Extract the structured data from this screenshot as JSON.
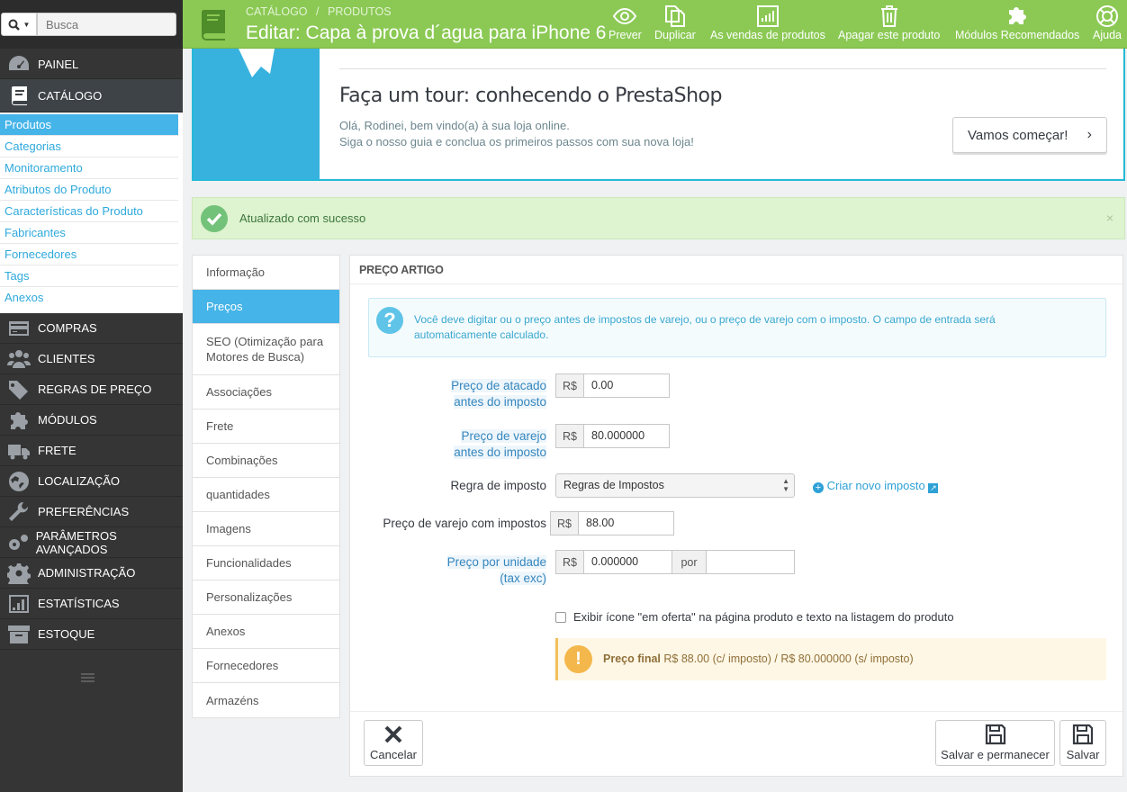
{
  "sidebar": {
    "search_placeholder": "Busca",
    "nav": [
      {
        "label": "PAINEL",
        "icon": "dashboard-icon"
      },
      {
        "label": "CATÁLOGO",
        "icon": "book-icon"
      },
      {
        "label": "COMPRAS",
        "icon": "credit-card-icon"
      },
      {
        "label": "CLIENTES",
        "icon": "users-icon"
      },
      {
        "label": "REGRAS DE PREÇO",
        "icon": "tags-icon"
      },
      {
        "label": "MÓDULOS",
        "icon": "puzzle-icon"
      },
      {
        "label": "FRETE",
        "icon": "truck-icon"
      },
      {
        "label": "LOCALIZAÇÃO",
        "icon": "globe-icon"
      },
      {
        "label": "PREFERÊNCIAS",
        "icon": "wrench-icon"
      },
      {
        "label": "PARÂMETROS AVANÇADOS",
        "icon": "cogs-icon"
      },
      {
        "label": "ADMINISTRAÇÃO",
        "icon": "gear-icon"
      },
      {
        "label": "ESTATÍSTICAS",
        "icon": "bar-chart-icon"
      },
      {
        "label": "ESTOQUE",
        "icon": "archive-icon"
      }
    ],
    "catalog_sub": [
      "Produtos",
      "Categorias",
      "Monitoramento",
      "Atributos do Produto",
      "Características do Produto",
      "Fabricantes",
      "Fornecedores",
      "Tags",
      "Anexos"
    ]
  },
  "header": {
    "breadcrumb": [
      "CATÁLOGO",
      "/",
      "PRODUTOS"
    ],
    "title": "Editar: Capa à prova d´agua para iPhone 6",
    "toolbar": [
      "Prever",
      "Duplicar",
      "As vendas de produtos",
      "Apagar este produto",
      "Módulos Recomendados",
      "Ajuda"
    ]
  },
  "tour": {
    "title": "Faça um tour: conhecendo o PrestaShop",
    "line1": "Olá, Rodinei, bem vindo(a) à sua loja online.",
    "line2": "Siga o nosso guia e conclua os primeiros passos com sua nova loja!",
    "button": "Vamos começar!"
  },
  "alert": {
    "text": "Atualizado com sucesso",
    "close": "×"
  },
  "tabs": [
    "Informação",
    "Preços",
    "SEO (Otimização para Motores de Busca)",
    "Associações",
    "Frete",
    "Combinações",
    "quantidades",
    "Imagens",
    "Funcionalidades",
    "Personalizações",
    "Anexos",
    "Fornecedores",
    "Armazéns"
  ],
  "panel": {
    "heading": "PREÇO ARTIGO",
    "info": "Você deve digitar ou o preço antes de impostos de varejo, ou o preço de varejo com o imposto. O campo de entrada será automaticamente calculado.",
    "wholesale_label_1": "Preço de atacado",
    "wholesale_label_2": "antes do imposto",
    "wholesale_value": "0.00",
    "retail_label_1": "Preço de varejo",
    "retail_label_2": "antes do imposto",
    "retail_value": "80.000000",
    "tax_rule_label": "Regra de imposto",
    "tax_rule_value": "Regras de Impostos",
    "new_tax_link": "Criar novo imposto",
    "retail_tax_label": "Preço de varejo com impostos",
    "retail_tax_value": "88.00",
    "unit_label_1": "Preço por unidade",
    "unit_label_2": "(tax exc)",
    "unit_value": "0.000000",
    "unit_per": "por",
    "unit_per_value": "",
    "currency": "R$",
    "onsale_label": "Exibir ícone \"em oferta\" na página produto e texto na listagem do produto",
    "final_label": "Preço final",
    "final_text": "R$ 88.00 (c/ imposto) / R$ 80.000000 (s/ imposto)",
    "cancel": "Cancelar",
    "save_stay": "Salvar e permanecer",
    "save": "Salvar"
  },
  "colors": {
    "header": "#8bc954",
    "active_tab": "#45b4e8",
    "sidebar": "#353535"
  }
}
